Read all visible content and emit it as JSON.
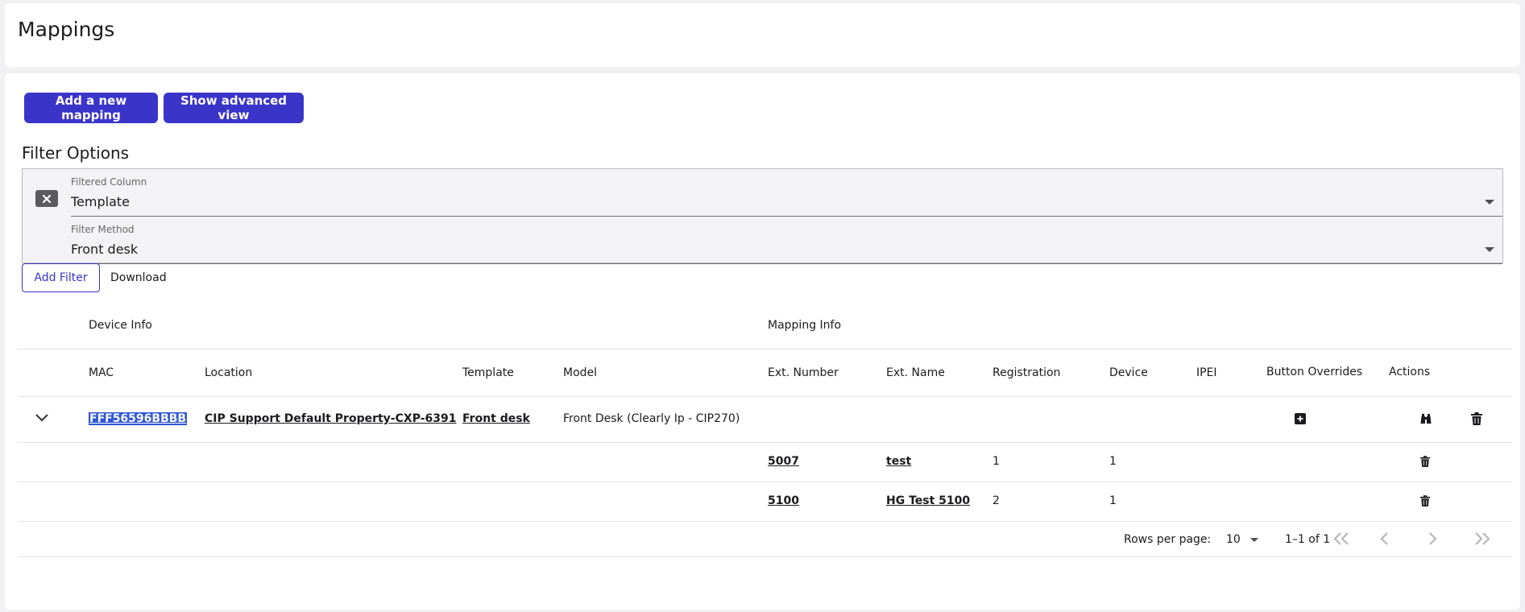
{
  "page": {
    "title": "Mappings"
  },
  "toolbar": {
    "add_mapping_label": "Add a new mapping",
    "advanced_view_label": "Show advanced view"
  },
  "filters": {
    "heading": "Filter Options",
    "column_label": "Filtered Column",
    "column_value": "Template",
    "method_label": "Filter Method",
    "method_value": "Front desk",
    "add_filter_label": "Add Filter",
    "download_label": "Download"
  },
  "table": {
    "group_headers": {
      "device_info": "Device Info",
      "mapping_info": "Mapping Info"
    },
    "columns": {
      "mac": "MAC",
      "location": "Location",
      "template": "Template",
      "model": "Model",
      "ext_number": "Ext. Number",
      "ext_name": "Ext. Name",
      "registration": "Registration",
      "device": "Device",
      "ipei": "IPEI",
      "button_overrides": "Button Overrides",
      "actions": "Actions"
    },
    "device": {
      "mac": "FFF56596BBBB",
      "location": "CIP Support Default Property-CXP-6391",
      "template": "Front desk",
      "model": "Front Desk (Clearly Ip - CIP270)"
    },
    "mappings": [
      {
        "ext_number": "5007",
        "ext_name": "test",
        "registration": "1",
        "device": "1"
      },
      {
        "ext_number": "5100",
        "ext_name": "HG Test 5100",
        "registration": "2",
        "device": "1"
      }
    ]
  },
  "pagination": {
    "rows_per_page_label": "Rows per page:",
    "rows_per_page_value": "10",
    "range_text": "1–1 of 1"
  },
  "colors": {
    "primary": "#3a34c9",
    "selection": "#2f56d6"
  }
}
